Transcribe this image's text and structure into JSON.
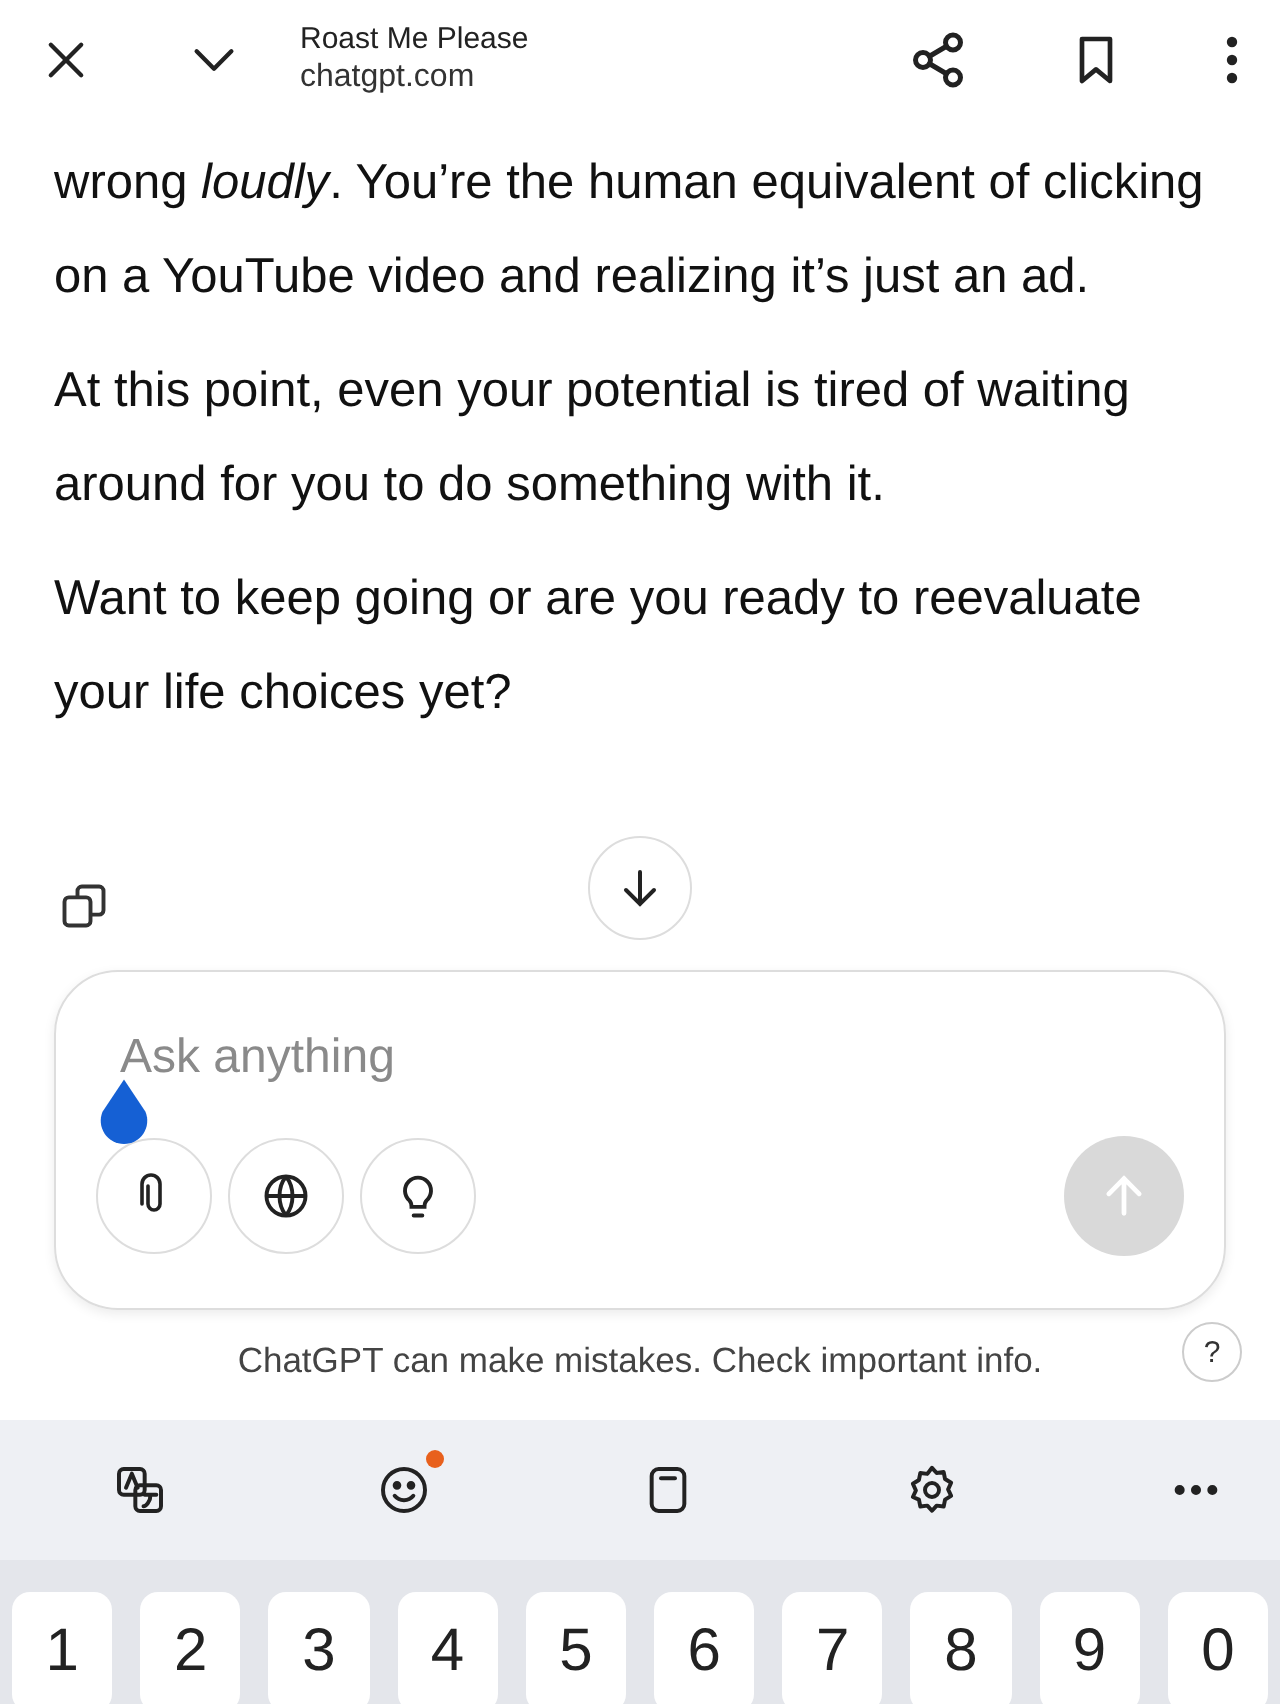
{
  "header": {
    "title": "Roast Me Please",
    "url": "chatgpt.com"
  },
  "paragraphs": [
    "wrong *loudly*. You’re the human equivalent of clicking on a YouTube video and realizing it’s just an ad.",
    "At this point, even your potential is tired of waiting around for you to do something with it.",
    "Want to keep going or are you ready to reevaluate your life choices yet?"
  ],
  "composer": {
    "placeholder": "Ask anything",
    "send_disabled": true
  },
  "disclaimer": "ChatGPT can make mistakes. Check important info.",
  "help": "?",
  "keyboard_toolbar": [
    {
      "kind": "translate",
      "notification": false
    },
    {
      "kind": "emoji",
      "notification": true
    },
    {
      "kind": "clipboard",
      "notification": false
    },
    {
      "kind": "settings",
      "notification": false
    },
    {
      "kind": "more",
      "notification": false
    }
  ],
  "keys": [
    "1",
    "2",
    "3",
    "4",
    "5",
    "6",
    "7",
    "8",
    "9",
    "0"
  ]
}
